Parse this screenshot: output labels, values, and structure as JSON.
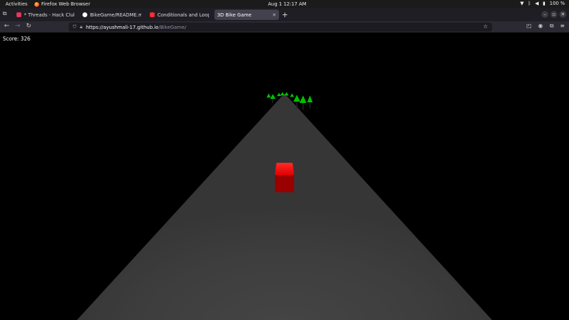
{
  "system_bar": {
    "activities": "Activities",
    "app_name": "Firefox Web Browser",
    "clock": "Aug 1  12:17 AM",
    "battery": "100 %"
  },
  "tabs": [
    {
      "title": "* Threads - Hack Club - Sl",
      "favicon_color": "#e8365d"
    },
    {
      "title": "BikeGame/README.md a",
      "favicon_color": "#ffffff"
    },
    {
      "title": "Conditionals and Loops",
      "favicon_color": "#ff2d2d"
    },
    {
      "title": "3D Bike Game",
      "favicon_color": "#42414d"
    }
  ],
  "active_tab": 3,
  "url": {
    "host": "https://ayushmali-17.github.io",
    "path": "/BikeGame/"
  },
  "game": {
    "score_label": "Score: 326",
    "road_color": "#3d3d3d",
    "bike_color": "#ff0000",
    "tree_color": "#00cc00"
  }
}
